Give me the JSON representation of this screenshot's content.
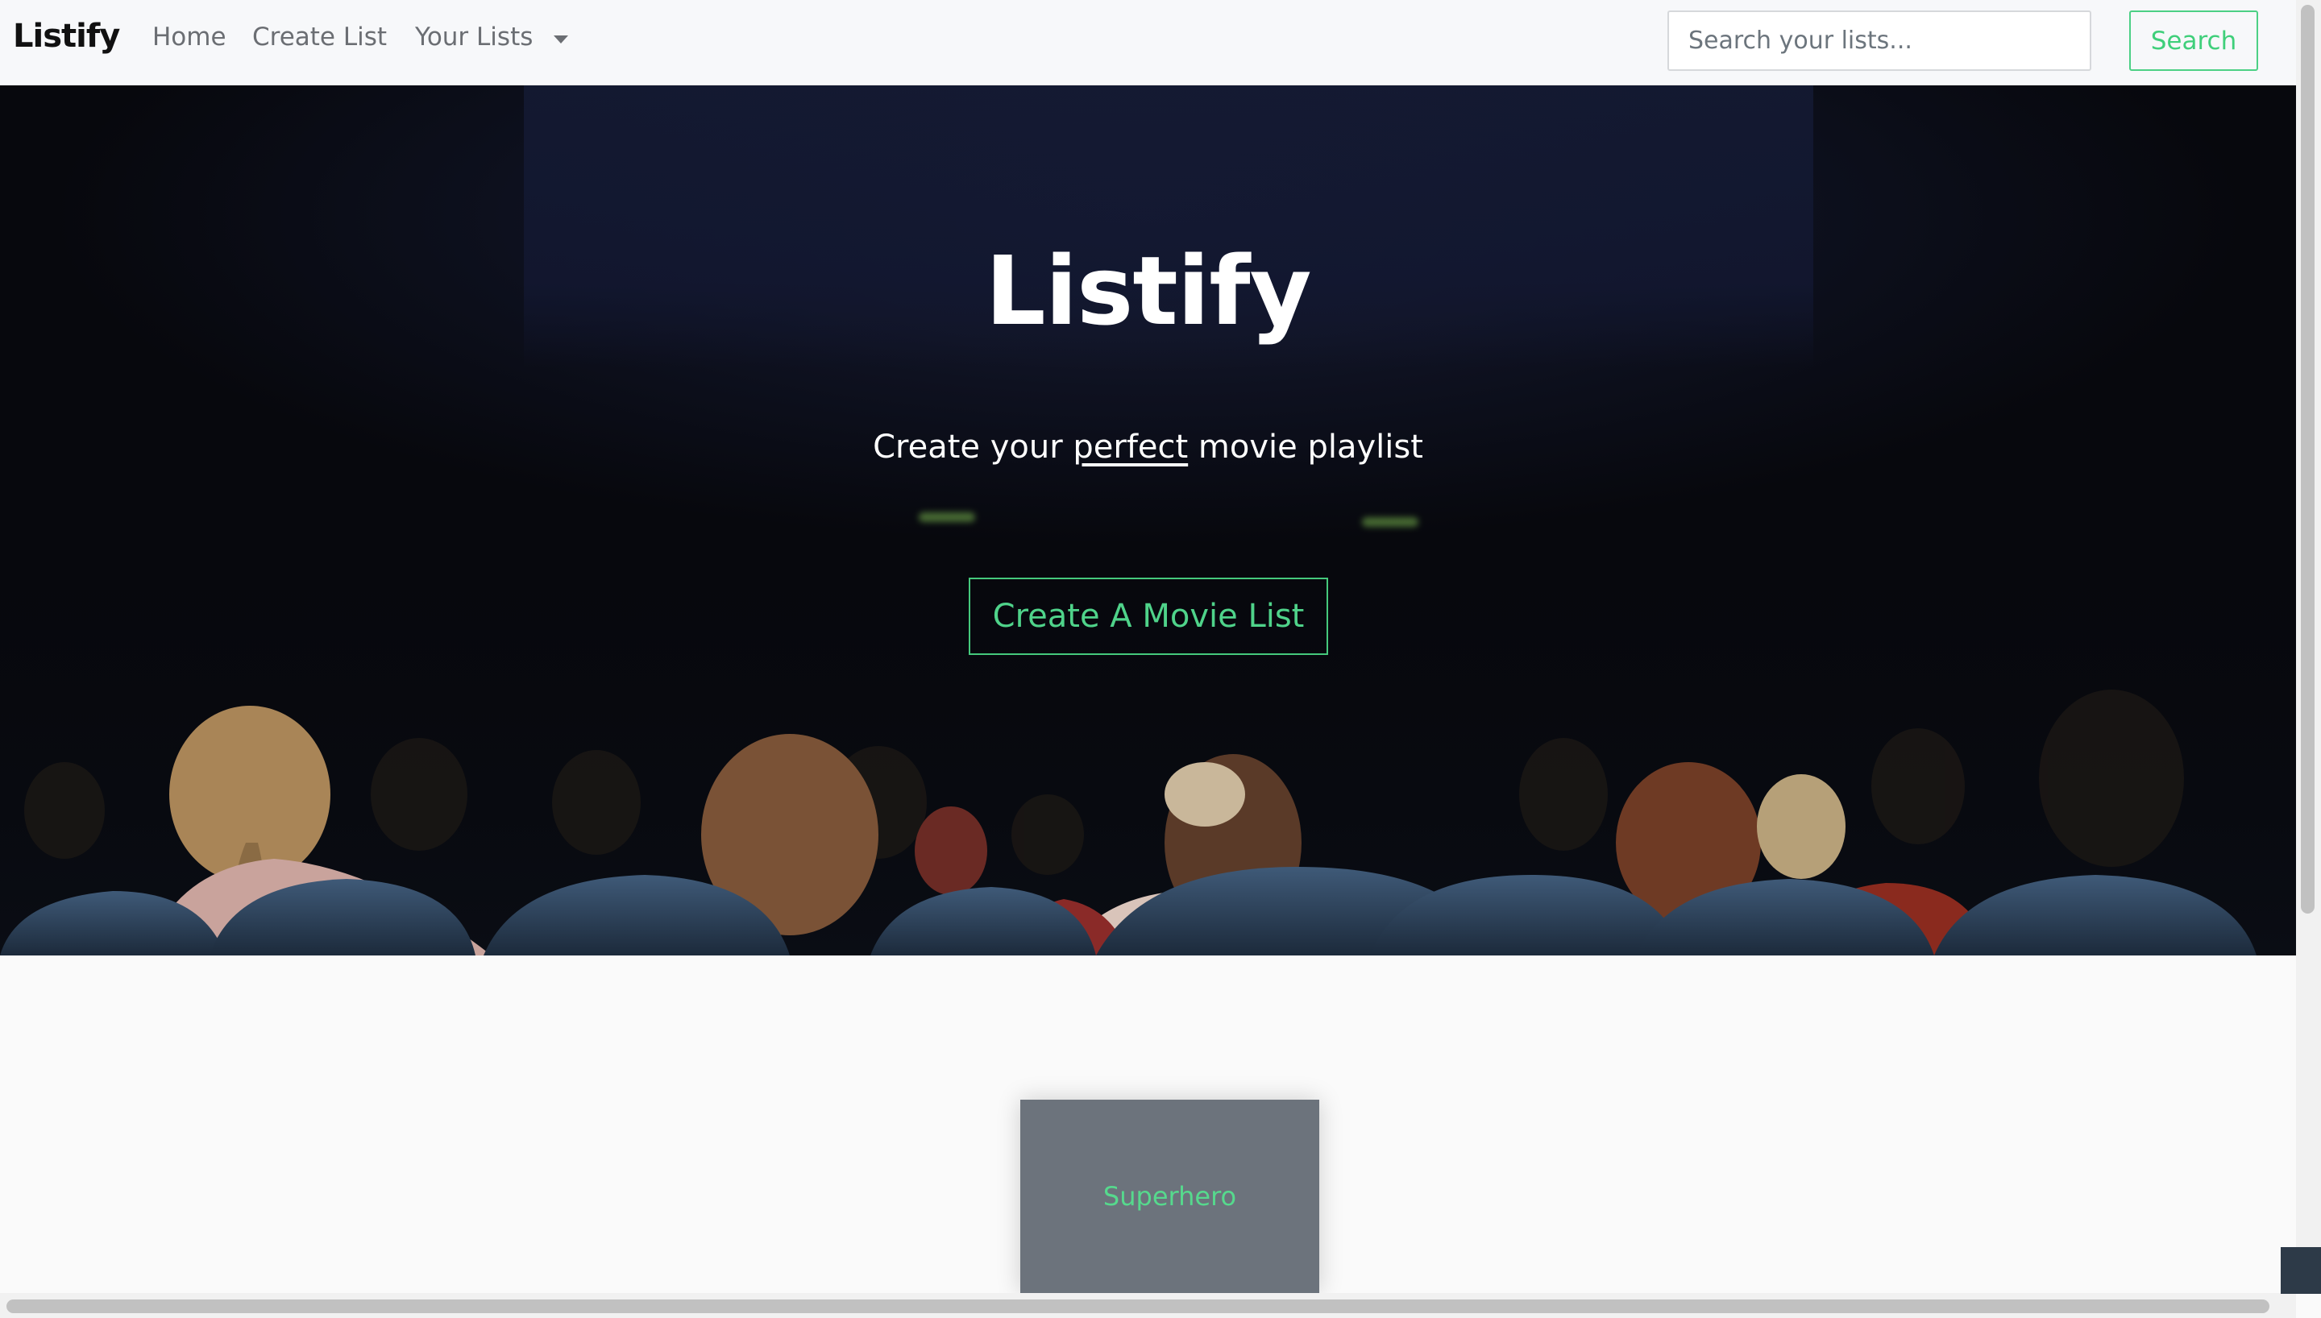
{
  "navbar": {
    "brand": "Listify",
    "links": [
      "Home",
      "Create List",
      "Your Lists"
    ],
    "search_placeholder": "Search your lists...",
    "search_button": "Search"
  },
  "hero": {
    "title": "Listify",
    "subtitle_before": "Create your ",
    "subtitle_emphasis": "perfect",
    "subtitle_after": " movie playlist",
    "cta_button": "Create A Movie List"
  },
  "lists": [
    {
      "name": "Superhero"
    }
  ],
  "colors": {
    "accent": "#3fcf7a",
    "navbar_bg": "#f7f8fa",
    "card_bg": "#6c737c",
    "hero_bg": "#0e1120"
  },
  "icons": {
    "dropdown": "caret-down-icon"
  }
}
